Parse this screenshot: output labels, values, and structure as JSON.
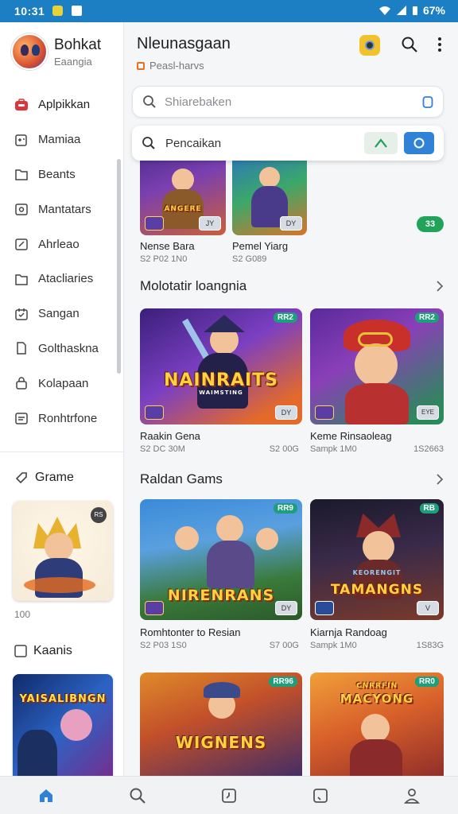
{
  "status": {
    "time": "10:31",
    "battery": "67%"
  },
  "profile": {
    "name": "Bohkat",
    "subtitle": "Eaangia"
  },
  "nav": {
    "items": [
      {
        "label": "Aplpikkan",
        "icon": "store-icon",
        "active": true
      },
      {
        "label": "Mamiaa",
        "icon": "gamepad-icon"
      },
      {
        "label": "Beants",
        "icon": "folder-icon"
      },
      {
        "label": "Mantatars",
        "icon": "image-icon"
      },
      {
        "label": "Ahrleao",
        "icon": "edit-icon"
      },
      {
        "label": "Atacliaries",
        "icon": "folder-icon"
      },
      {
        "label": "Sangan",
        "icon": "calendar-icon"
      },
      {
        "label": "Golthaskna",
        "icon": "document-icon"
      },
      {
        "label": "Kolapaan",
        "icon": "lock-icon"
      },
      {
        "label": "Ronhtrfone",
        "icon": "list-icon"
      }
    ]
  },
  "side": {
    "games_label": "Grame",
    "games_caption": "100",
    "recent_label": "Kaanis",
    "card1_badge": "RS",
    "card2_title": "YAISALIBNGN"
  },
  "header": {
    "title": "Nleunasgaan",
    "subtitle": "Peasl-harvs"
  },
  "search": {
    "placeholder": "Shiarebaken",
    "query": "Pencaikan"
  },
  "top_row": [
    {
      "name": "Nense Bara",
      "meta": "S2 P02 1N0",
      "badge": "JY",
      "art": "ANGERE"
    },
    {
      "name": "Pemel Yiarg",
      "meta": "S2 G089",
      "badge": "DY"
    }
  ],
  "green_pill": "33",
  "sections": [
    {
      "title": "Molotatir loangnia",
      "games": [
        {
          "name": "Raakin Gena",
          "meta": "S2 DC 30M",
          "meta_r": "S2 00G",
          "tag": "RR2",
          "art": "NAINRAITS",
          "art_sub": "WAIMSTING",
          "badge": "DY"
        },
        {
          "name": "Keme Rinsaoleag",
          "meta": "Sampk 1M0",
          "meta_r": "1S2663",
          "tag": "RR2",
          "badge": "EYE"
        }
      ]
    },
    {
      "title": "Raldan Gams",
      "games": [
        {
          "name": "Romhtonter to Resian",
          "meta": "S2 P03 1S0",
          "meta_r": "S7 00G",
          "tag": "RR9",
          "art": "NIRENRANS",
          "badge": "DY"
        },
        {
          "name": "Kiarnja Randoag",
          "meta": "Sampk 1M0",
          "meta_r": "1S83G",
          "tag": "RB",
          "art": "TAMANGNS",
          "art_sub": "KEORENGIT",
          "badge": "V"
        }
      ]
    },
    {
      "title": "",
      "games": [
        {
          "name": "",
          "tag": "RR96",
          "art": "WIGNENS"
        },
        {
          "name": "",
          "tag": "RR0",
          "art": "MACYONG",
          "art_sub": "CNRRFIN"
        }
      ]
    }
  ],
  "bottom_nav": [
    {
      "icon": "home-icon",
      "active": true
    },
    {
      "icon": "search-icon"
    },
    {
      "icon": "clock-icon"
    },
    {
      "icon": "chart-icon"
    },
    {
      "icon": "profile-icon"
    }
  ],
  "colors": {
    "status_bar": "#1c7fc4",
    "accent": "#2f82d6",
    "active_nav": "#d9363e",
    "green": "#21a45a"
  }
}
